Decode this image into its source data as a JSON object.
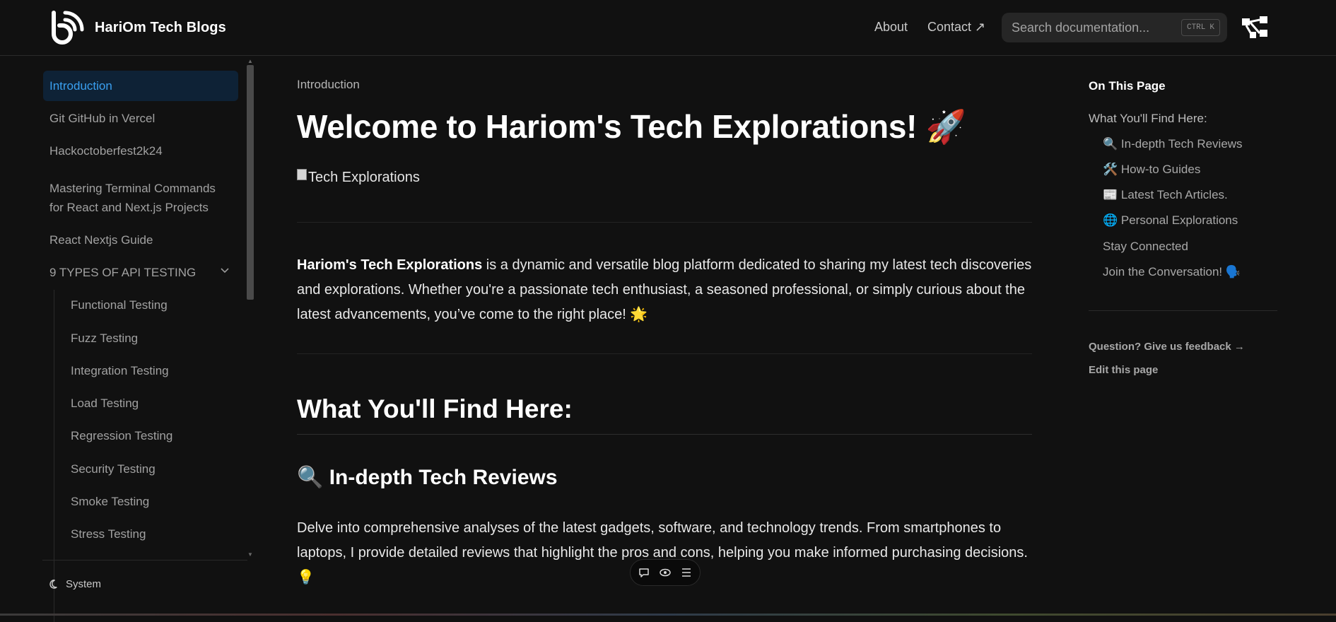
{
  "header": {
    "brand": "HariOm Tech Blogs",
    "nav_about": "About",
    "nav_contact": "Contact ↗",
    "search_placeholder": "Search documentation...",
    "search_kbd_ctrl": "CTRL",
    "search_kbd_k": "K"
  },
  "sidebar": {
    "items": [
      {
        "label": "Introduction",
        "active": true
      },
      {
        "label": "Git GitHub in Vercel"
      },
      {
        "label": "Hackoctoberfest2k24"
      },
      {
        "label": "Mastering Terminal Commands for React and Next.js Projects"
      },
      {
        "label": "React Nextjs Guide"
      },
      {
        "label": "9 TYPES OF API TESTING",
        "expanded": true
      }
    ],
    "subitems": [
      {
        "label": "Functional Testing"
      },
      {
        "label": "Fuzz Testing"
      },
      {
        "label": "Integration Testing"
      },
      {
        "label": "Load Testing"
      },
      {
        "label": "Regression Testing"
      },
      {
        "label": "Security Testing"
      },
      {
        "label": "Smoke Testing"
      },
      {
        "label": "Stress Testing"
      }
    ],
    "theme_label": "System"
  },
  "main": {
    "breadcrumb": "Introduction",
    "title": "Welcome to Hariom's Tech Explorations! 🚀",
    "image_alt": "Tech Explorations",
    "intro_bold": "Hariom's Tech Explorations",
    "intro_rest": " is a dynamic and versatile blog platform dedicated to sharing my latest tech discoveries and explorations. Whether you're a passionate tech enthusiast, a seasoned professional, or simply curious about the latest advancements, you’ve come to the right place! 🌟",
    "h2": "What You'll Find Here:",
    "h3": "🔍 In-depth Tech Reviews",
    "reviews_para": "Delve into comprehensive analyses of the latest gadgets, software, and technology trends. From smartphones to laptops, I provide detailed reviews that highlight the pros and cons, helping you make informed purchasing decisions. 💡"
  },
  "toc": {
    "title": "On This Page",
    "items": [
      {
        "label": "What You'll Find Here:",
        "level": 1
      },
      {
        "label": "🔍 In-depth Tech Reviews",
        "level": 2
      },
      {
        "label": "🛠️ How-to Guides",
        "level": 2
      },
      {
        "label": "📰 Latest Tech Articles.",
        "level": 2
      },
      {
        "label": "🌐 Personal Explorations",
        "level": 2
      },
      {
        "label": "Stay Connected",
        "level": 2
      },
      {
        "label": "Join the Conversation! 🗣️",
        "level": 2
      }
    ],
    "feedback": "Question? Give us feedback →",
    "edit": "Edit this page"
  },
  "colors": {
    "background": "#111111",
    "accent": "#3aa0f0",
    "active_bg": "#0e2236"
  },
  "icons": {
    "logo": "signal-b-logo-icon",
    "sitemap": "sitemap-icon",
    "theme": "moon-icon",
    "chevron": "chevron-down-icon",
    "float": [
      "comment-icon",
      "eye-icon",
      "list-icon"
    ]
  }
}
